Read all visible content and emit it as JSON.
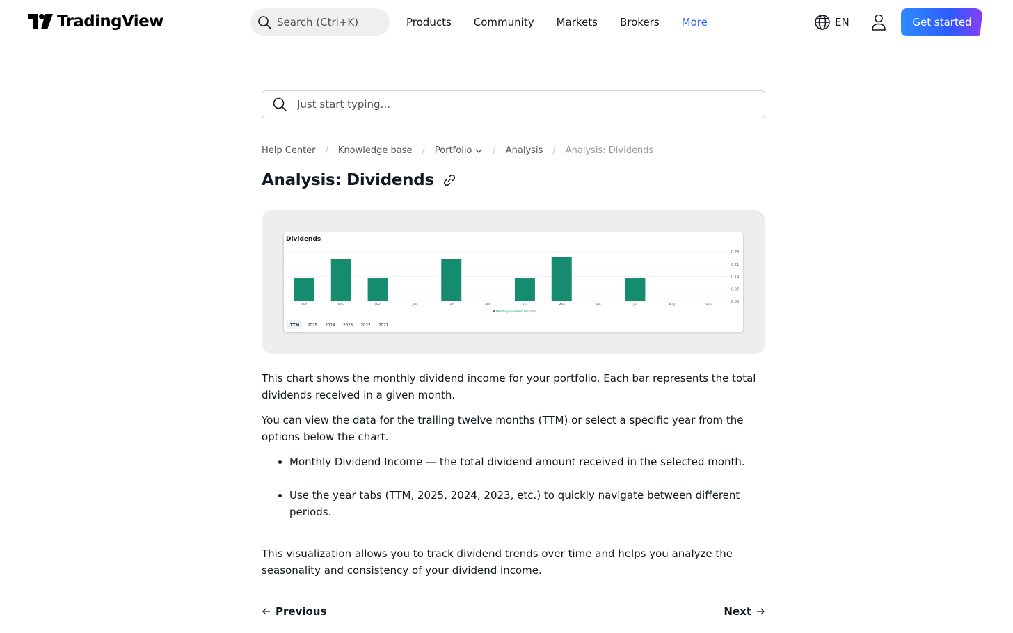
{
  "header": {
    "logo_text": "TradingView",
    "search_label": "Search (Ctrl+K)",
    "nav": [
      "Products",
      "Community",
      "Markets",
      "Brokers",
      "More"
    ],
    "lang": "EN",
    "cta": "Get started"
  },
  "main_search": {
    "placeholder": "Just start typing..."
  },
  "breadcrumb": [
    "Help Center",
    "Knowledge base",
    "Portfolio",
    "Analysis",
    "Analysis: Dividends"
  ],
  "title": "Analysis: Dividends",
  "body": {
    "p1": "This chart shows the monthly dividend income for your portfolio. Each bar represents the total dividends received in a given month.",
    "p2": "You can view the data for the trailing twelve months (TTM) or select a specific year from the options below the chart.",
    "bullets": [
      "Monthly Dividend Income — the total dividend amount received in the selected month.",
      "Use the year tabs (TTM, 2025, 2024, 2023, etc.) to quickly navigate between different periods."
    ],
    "p3": "This visualization allows you to track dividend trends over time and helps you analyze the seasonality and consistency of your dividend income."
  },
  "pager": {
    "prev": "Previous",
    "next": "Next"
  },
  "colors": {
    "accent": "#2962ff",
    "bar": "#158b6f"
  },
  "chart_data": {
    "type": "bar",
    "title": "Dividends",
    "categories": [
      "Oct",
      "Nov",
      "Dec",
      "Jan",
      "Feb",
      "Mar",
      "Apr",
      "May",
      "Jun",
      "Jul",
      "Aug",
      "Sep"
    ],
    "series": [
      {
        "name": "Monthly dividend income",
        "values": [
          0.13,
          0.24,
          0.13,
          0.0,
          0.24,
          0.0,
          0.13,
          0.25,
          0.0,
          0.13,
          0.0,
          0.0
        ]
      }
    ],
    "yticks": [
      "0.28",
      "0.21",
      "0.14",
      "0.07",
      "0.00"
    ],
    "ylim": [
      0,
      0.28
    ],
    "grid": true,
    "legend": "bottom",
    "year_tabs": [
      "TTM",
      "2025",
      "2024",
      "2023",
      "2022",
      "2021"
    ],
    "selected_tab": "TTM"
  }
}
